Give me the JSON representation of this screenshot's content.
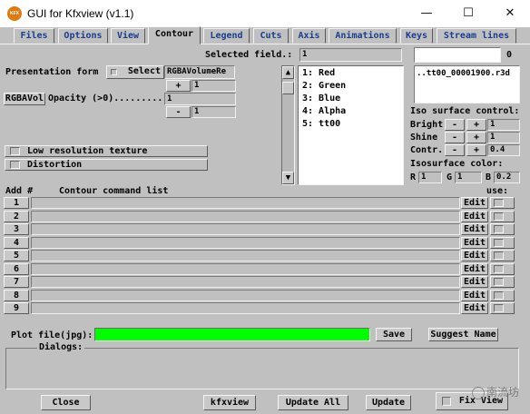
{
  "window": {
    "title": "GUI for Kfxview (v1.1)",
    "icon_label": "KFX",
    "controls": [
      "minimize-icon",
      "maximize-icon",
      "close-icon"
    ]
  },
  "tabs": [
    "Files",
    "Options",
    "View",
    "Contour",
    "Legend",
    "Cuts",
    "Axis",
    "Animations",
    "Keys",
    "Stream lines"
  ],
  "active_tab": "Contour",
  "selected_field": {
    "label": "Selected field.:",
    "value": "1"
  },
  "top_right": {
    "value": "0",
    "filename": "..tt00_00001900.r3d"
  },
  "presentation": {
    "label": "Presentation form",
    "select_label": "Select",
    "value": "RGBAVolumeRe",
    "plus_label": "+",
    "plus_value": "1",
    "minus_label": "-",
    "minus_value": "1",
    "mode_button": "RGBAVol",
    "opacity_label": "Opacity (>0).........",
    "opacity_value": "1"
  },
  "field_list": [
    "1: Red",
    "2: Green",
    "3: Blue",
    "4: Alpha",
    "5: tt00"
  ],
  "iso_surface": {
    "title": "Iso surface control:",
    "rows": [
      {
        "label": "Bright",
        "value": "1"
      },
      {
        "label": "Shine",
        "value": "1"
      },
      {
        "label": "Contr.",
        "value": "0.4"
      }
    ],
    "minus": "-",
    "plus": "+",
    "color_title": "Isosurface color:",
    "color": [
      {
        "label": "R",
        "value": "1"
      },
      {
        "label": "G",
        "value": "1"
      },
      {
        "label": "B",
        "value": "0.2"
      }
    ]
  },
  "options": {
    "low_res": "Low resolution texture",
    "distortion": "Distortion"
  },
  "contour": {
    "add_header": "Add #",
    "list_header": "Contour command list",
    "use_header": "use:",
    "edit_label": "Edit",
    "rows": [
      "1",
      "2",
      "3",
      "4",
      "5",
      "6",
      "7",
      "8",
      "9"
    ]
  },
  "plot": {
    "label": "Plot file(jpg):",
    "value": "",
    "field_color": "#00ff00",
    "save": "Save",
    "suggest": "Suggest Name"
  },
  "dialogs": {
    "label": "Dialogs:"
  },
  "footer": {
    "close": "Close",
    "kfxview": "kfxview",
    "update_all": "Update All",
    "update": "Update",
    "fix_view": "Fix View"
  },
  "watermark": "南流坊"
}
